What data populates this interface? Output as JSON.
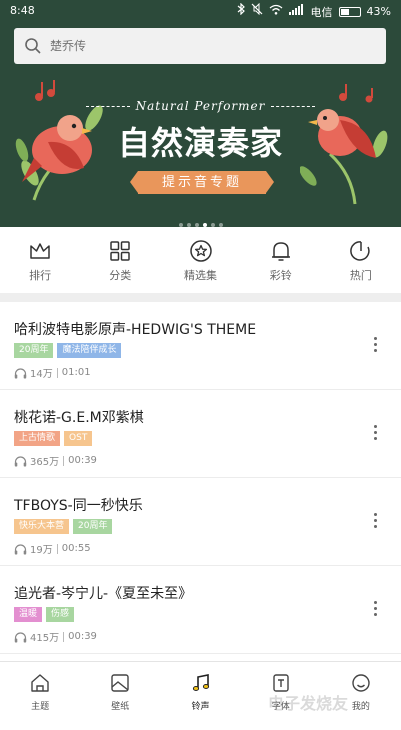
{
  "status_bar": {
    "time": "8:48",
    "carrier": "电信",
    "battery": "43%"
  },
  "search": {
    "placeholder": "楚乔传"
  },
  "banner": {
    "subtitle": "Natural Performer",
    "title": "自然演奏家",
    "tag": "提示音专题",
    "page_count": 6,
    "active_page": 4
  },
  "categories": [
    {
      "label": "排行",
      "icon": "crown-icon"
    },
    {
      "label": "分类",
      "icon": "grid-icon"
    },
    {
      "label": "精选集",
      "icon": "star-circle-icon"
    },
    {
      "label": "彩铃",
      "icon": "bell-icon"
    },
    {
      "label": "热门",
      "icon": "refresh-icon"
    }
  ],
  "songs": [
    {
      "title": "哈利波特电影原声-HEDWIG'S THEME",
      "tags": [
        {
          "text": "20周年",
          "color": "#a8d6a0"
        },
        {
          "text": "魔法陪伴成长",
          "color": "#8fb6e8"
        }
      ],
      "plays": "14万",
      "duration": "01:01"
    },
    {
      "title": "桃花诺-G.E.M邓紫棋",
      "tags": [
        {
          "text": "上古情歌",
          "color": "#f2a486"
        },
        {
          "text": "OST",
          "color": "#f6c58e"
        }
      ],
      "plays": "365万",
      "duration": "00:39"
    },
    {
      "title": "TFBOYS-同一秒快乐",
      "tags": [
        {
          "text": "快乐大本营",
          "color": "#f6c58e"
        },
        {
          "text": "20周年",
          "color": "#a8d6a0"
        }
      ],
      "plays": "19万",
      "duration": "00:55"
    },
    {
      "title": "追光者-岑宁儿-《夏至未至》",
      "tags": [
        {
          "text": "温暖",
          "color": "#e38fd0"
        },
        {
          "text": "伤感",
          "color": "#a8d6a0"
        }
      ],
      "plays": "415万",
      "duration": "00:39"
    }
  ],
  "tabbar": [
    {
      "label": "主题",
      "icon": "home-icon"
    },
    {
      "label": "壁纸",
      "icon": "wallpaper-icon"
    },
    {
      "label": "铃声",
      "icon": "music-note-icon",
      "active": true
    },
    {
      "label": "字体",
      "icon": "font-icon"
    },
    {
      "label": "我的",
      "icon": "face-icon"
    }
  ],
  "watermark": "电子发烧友"
}
